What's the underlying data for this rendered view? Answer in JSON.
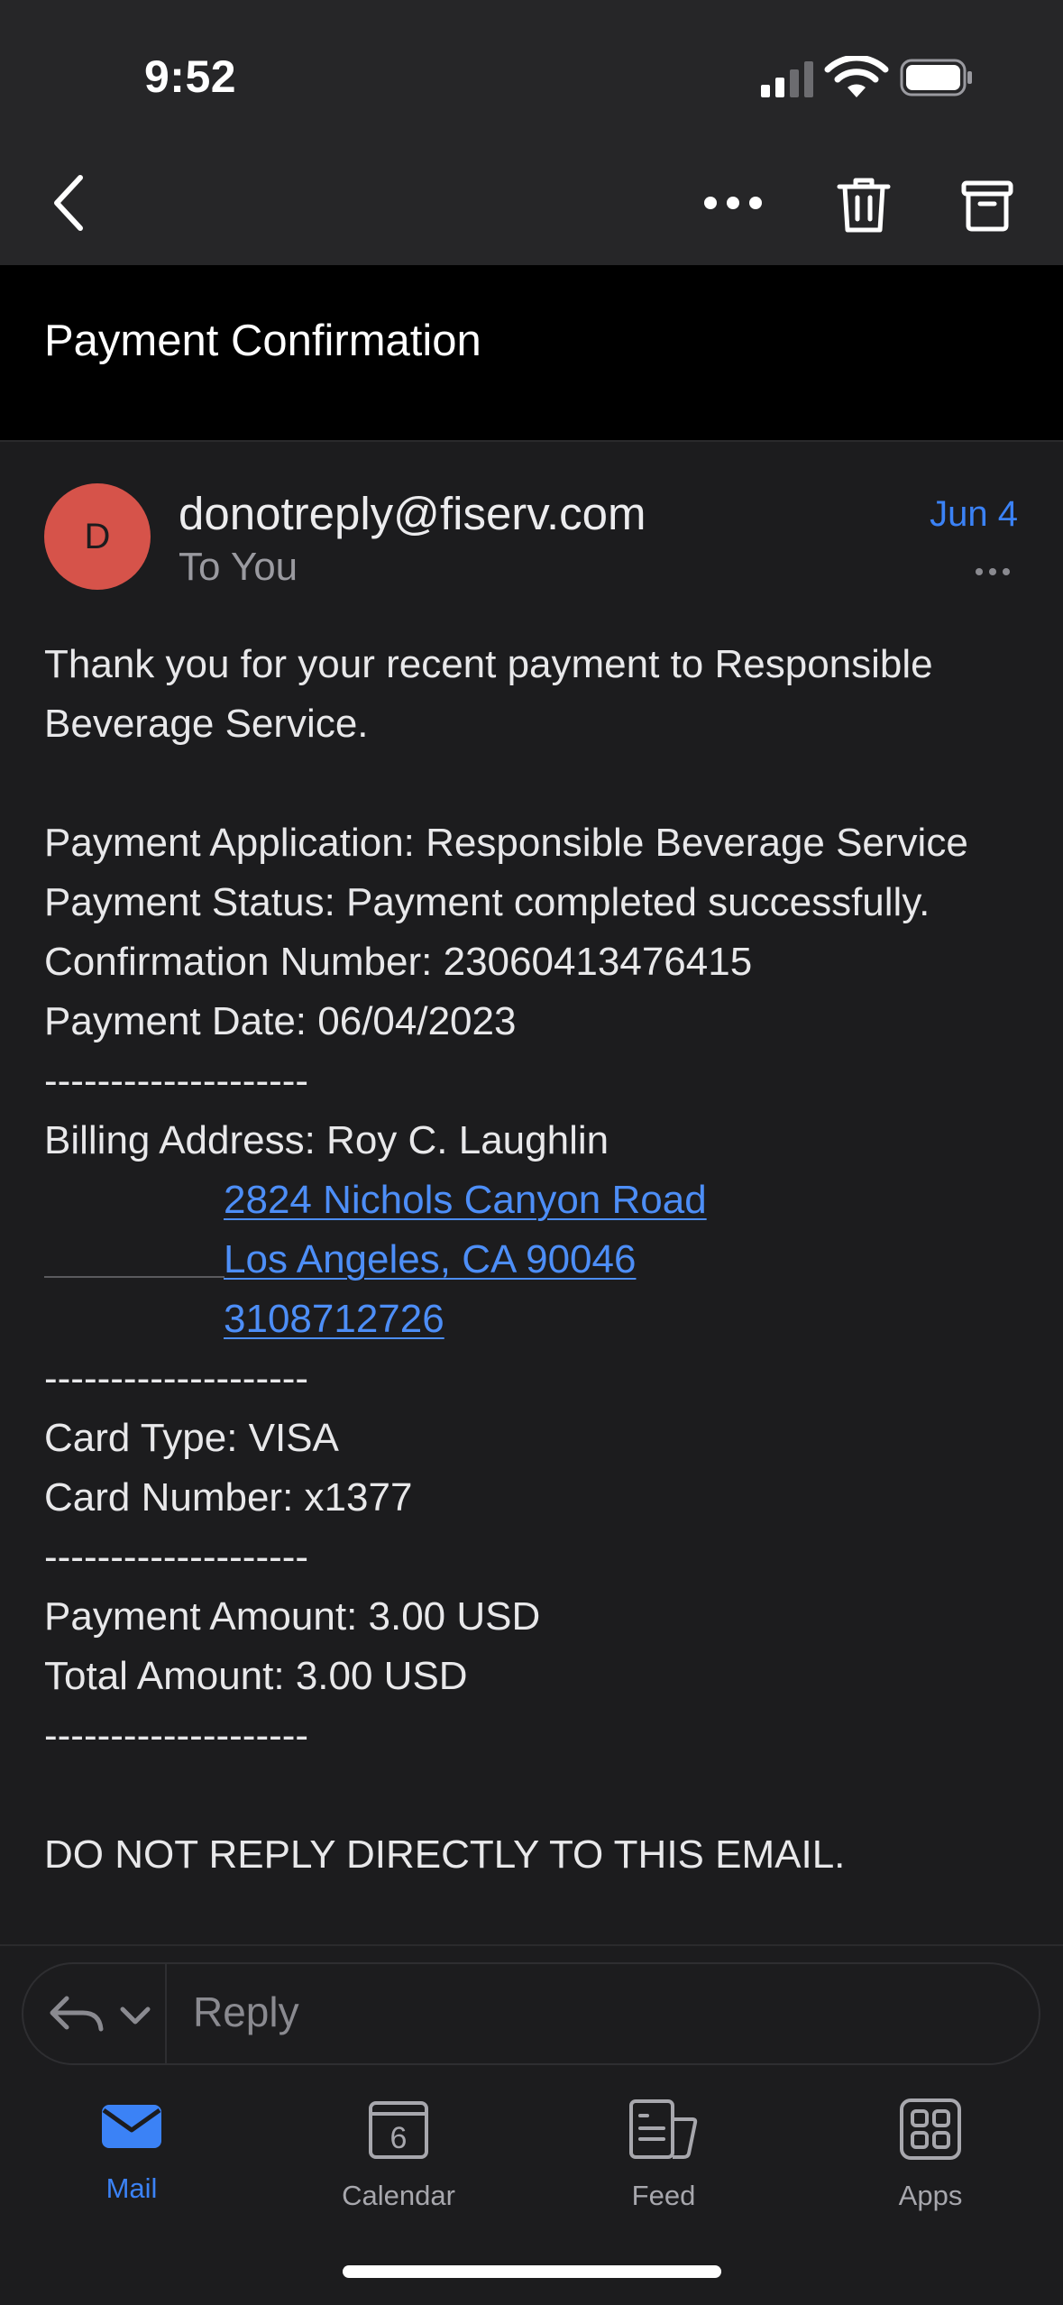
{
  "status_bar": {
    "time": "9:52"
  },
  "nav": {
    "back_icon": "chevron-left-icon",
    "more_icon": "more-horizontal-icon",
    "delete_icon": "trash-icon",
    "archive_icon": "archive-icon"
  },
  "email": {
    "subject": "Payment Confirmation",
    "avatar_initial": "D",
    "avatar_color": "#d6534a",
    "sender": "donotreply@fiserv.com",
    "recipient": "To You",
    "date": "Jun 4",
    "body": {
      "intro_1": "Thank you for your recent payment to Responsible",
      "intro_2": "Beverage Service.",
      "application": "Payment Application: Responsible Beverage Service",
      "status": "Payment Status: Payment completed successfully.",
      "confirmation": "Confirmation Number: 23060413476415",
      "payment_date": "Payment Date: 06/04/2023",
      "separator": "--------------------",
      "billing_label": "Billing Address: Roy C. Laughlin",
      "address_line1": "2824 Nichols Canyon Road",
      "address_line2": "Los Angeles, CA 90046",
      "phone": "3108712726",
      "card_type": "Card Type: VISA",
      "card_number": "Card Number: x1377",
      "payment_amount": "Payment Amount: 3.00 USD",
      "total_amount": "Total Amount: 3.00 USD",
      "footer": "DO NOT REPLY DIRECTLY TO THIS EMAIL."
    }
  },
  "reply": {
    "placeholder": "Reply"
  },
  "tabs": [
    {
      "label": "Mail",
      "icon": "mail-icon",
      "active": true
    },
    {
      "label": "Calendar",
      "icon": "calendar-icon",
      "badge": "6",
      "active": false
    },
    {
      "label": "Feed",
      "icon": "feed-icon",
      "active": false
    },
    {
      "label": "Apps",
      "icon": "apps-grid-icon",
      "active": false
    }
  ],
  "colors": {
    "accent": "#3b82f6",
    "link": "#4d8ef7",
    "background": "#1c1c1e",
    "header": "#262628"
  }
}
